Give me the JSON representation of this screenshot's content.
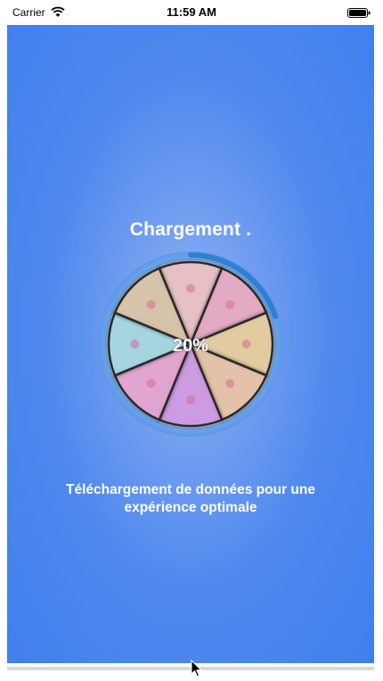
{
  "status_bar": {
    "carrier": "Carrier",
    "time": "11:59 AM",
    "icons": [
      "wifi-icon",
      "battery-icon"
    ]
  },
  "screen": {
    "title": "Chargement .",
    "progress_label": "20%",
    "progress": 0.2,
    "subtitle_line1": "Téléchargement  de données pour une",
    "subtitle_line2": "expérience optimale",
    "wheel_segments": [
      {
        "color": "#f7c6c6",
        "icon": "egg-icon"
      },
      {
        "color": "#f4a9c4",
        "icon": "drink-icon"
      },
      {
        "color": "#f3d39b",
        "icon": "box-icon"
      },
      {
        "color": "#f6c7a6",
        "icon": "leaf-icon"
      },
      {
        "color": "#d797e9",
        "icon": "cookie-icon"
      },
      {
        "color": "#f0a4d4",
        "icon": "grain-icon"
      },
      {
        "color": "#a7e0e8",
        "icon": "dice-icon"
      },
      {
        "color": "#e3c8a6",
        "icon": "fish-icon"
      }
    ],
    "colors": {
      "background": "#4f89ee",
      "ring": "#6aa8e8",
      "progress_arc": "#2f7fd2",
      "text": "#ffffff"
    }
  }
}
